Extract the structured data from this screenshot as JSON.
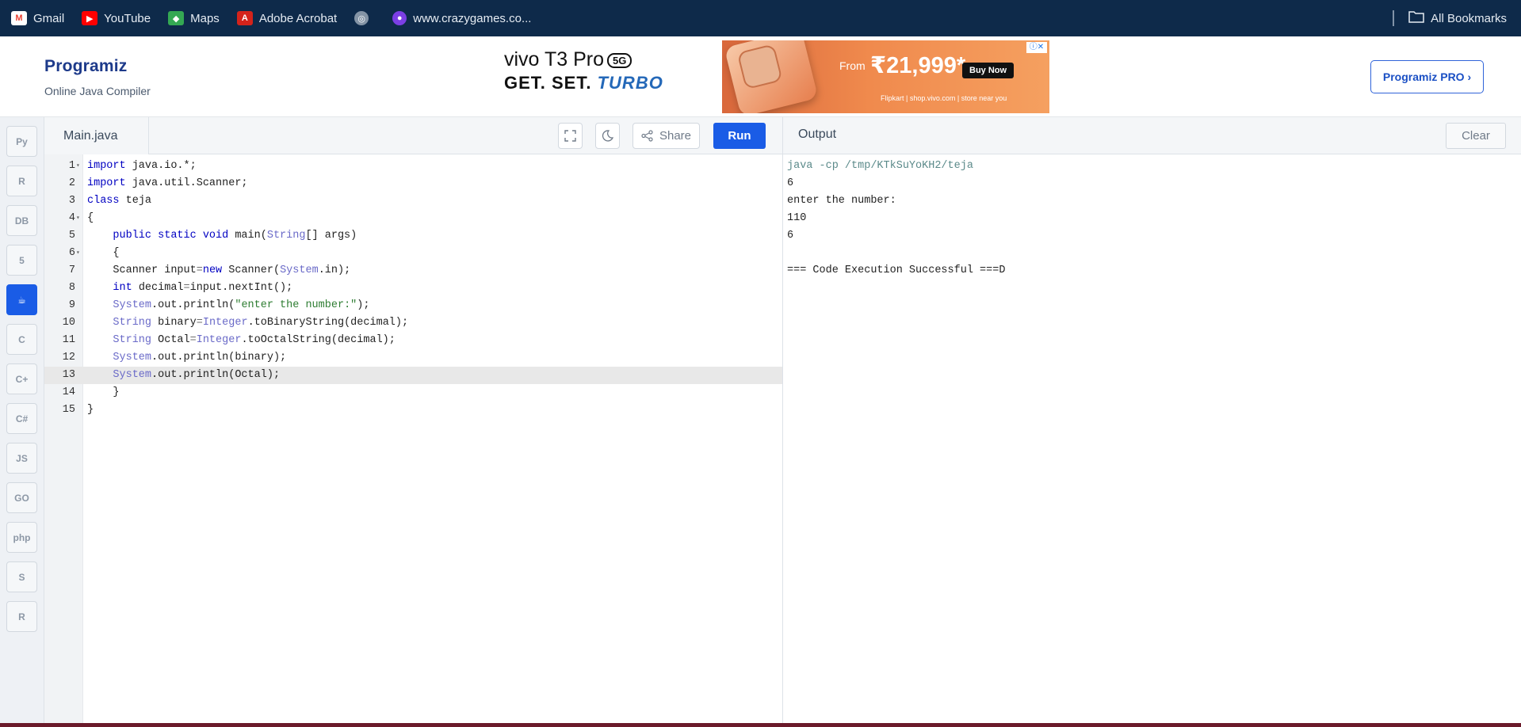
{
  "bookmarks": {
    "items": [
      {
        "label": "Gmail",
        "icon": "gmail-icon",
        "color": "#ea4335"
      },
      {
        "label": "YouTube",
        "icon": "youtube-icon",
        "color": "#ff0000"
      },
      {
        "label": "Maps",
        "icon": "maps-icon",
        "color": "#34a853"
      },
      {
        "label": "Adobe Acrobat",
        "icon": "acrobat-icon",
        "color": "#d4231b"
      },
      {
        "label": "",
        "icon": "globe-icon",
        "color": "#9aa7b5"
      },
      {
        "label": "www.crazygames.co...",
        "icon": "crazygames-icon",
        "color": "#7b3fe4"
      }
    ],
    "all_bookmarks": "All Bookmarks"
  },
  "header": {
    "logo": "Programiz",
    "subtitle": "Online Java Compiler",
    "pro_button": "Programiz PRO ›"
  },
  "ad": {
    "line1": "vivo T3 Pro",
    "badge": "5G",
    "line2_a": "GET. SET.",
    "line2_b": "TURBO",
    "from": "From",
    "price": "₹21,999*",
    "buy": "Buy Now",
    "footer": "Flipkart  |  shop.vivo.com  |  store near you"
  },
  "languages": [
    {
      "name": "python-icon",
      "label": "Py",
      "active": false
    },
    {
      "name": "r-icon",
      "label": "R",
      "active": false
    },
    {
      "name": "sql-icon",
      "label": "DB",
      "active": false
    },
    {
      "name": "html5-icon",
      "label": "5",
      "active": false
    },
    {
      "name": "java-icon",
      "label": "☕",
      "active": true
    },
    {
      "name": "c-icon",
      "label": "C",
      "active": false
    },
    {
      "name": "cpp-icon",
      "label": "C+",
      "active": false
    },
    {
      "name": "csharp-icon",
      "label": "C#",
      "active": false
    },
    {
      "name": "js-icon",
      "label": "JS",
      "active": false
    },
    {
      "name": "go-icon",
      "label": "GO",
      "active": false
    },
    {
      "name": "php-icon",
      "label": "php",
      "active": false
    },
    {
      "name": "swift-icon",
      "label": "S",
      "active": false
    },
    {
      "name": "rust-icon",
      "label": "R",
      "active": false
    }
  ],
  "editor": {
    "filename": "Main.java",
    "share": "Share",
    "run": "Run",
    "active_line": 13,
    "lines": [
      {
        "n": "1",
        "fold": true
      },
      {
        "n": "2",
        "fold": false
      },
      {
        "n": "3",
        "fold": false
      },
      {
        "n": "4",
        "fold": true
      },
      {
        "n": "5",
        "fold": false
      },
      {
        "n": "6",
        "fold": true
      },
      {
        "n": "7",
        "fold": false
      },
      {
        "n": "8",
        "fold": false
      },
      {
        "n": "9",
        "fold": false
      },
      {
        "n": "10",
        "fold": false
      },
      {
        "n": "11",
        "fold": false
      },
      {
        "n": "12",
        "fold": false
      },
      {
        "n": "13",
        "fold": false
      },
      {
        "n": "14",
        "fold": false
      },
      {
        "n": "15",
        "fold": false
      }
    ],
    "code": {
      "l1a": "import",
      "l1b": " java.io.*;",
      "l2a": "import",
      "l2b": " java.util.Scanner;",
      "l3a": "class",
      "l3b": " teja",
      "l4": "{",
      "l5a": "    public static void",
      "l5b": " main(",
      "l5c": "String",
      "l5d": "[] args)",
      "l6": "    {",
      "l7a": "    Scanner input",
      "l7b": "=",
      "l7c": "new",
      "l7d": " Scanner(",
      "l7e": "System",
      "l7f": ".in);",
      "l8a": "    int",
      "l8b": " decimal",
      "l8c": "=",
      "l8d": "input.nextInt();",
      "l9a": "    System",
      "l9b": ".out.println(",
      "l9c": "\"enter the number:\"",
      "l9d": ");",
      "l10a": "    String",
      "l10b": " binary",
      "l10c": "=",
      "l10d": "Integer",
      "l10e": ".toBinaryString(decimal);",
      "l11a": "    String",
      "l11b": " Octal",
      "l11c": "=",
      "l11d": "Integer",
      "l11e": ".toOctalString(decimal);",
      "l12a": "    System",
      "l12b": ".out.println(binary);",
      "l13a": "    System",
      "l13b": ".out.println(Octal);",
      "l14": "    }",
      "l15": "}"
    }
  },
  "output": {
    "title": "Output",
    "clear": "Clear",
    "lines": [
      "java -cp /tmp/KTkSuYoKH2/teja",
      "6",
      "enter the number:",
      "110",
      "6",
      "",
      "=== Code Execution Successful ===D"
    ]
  }
}
